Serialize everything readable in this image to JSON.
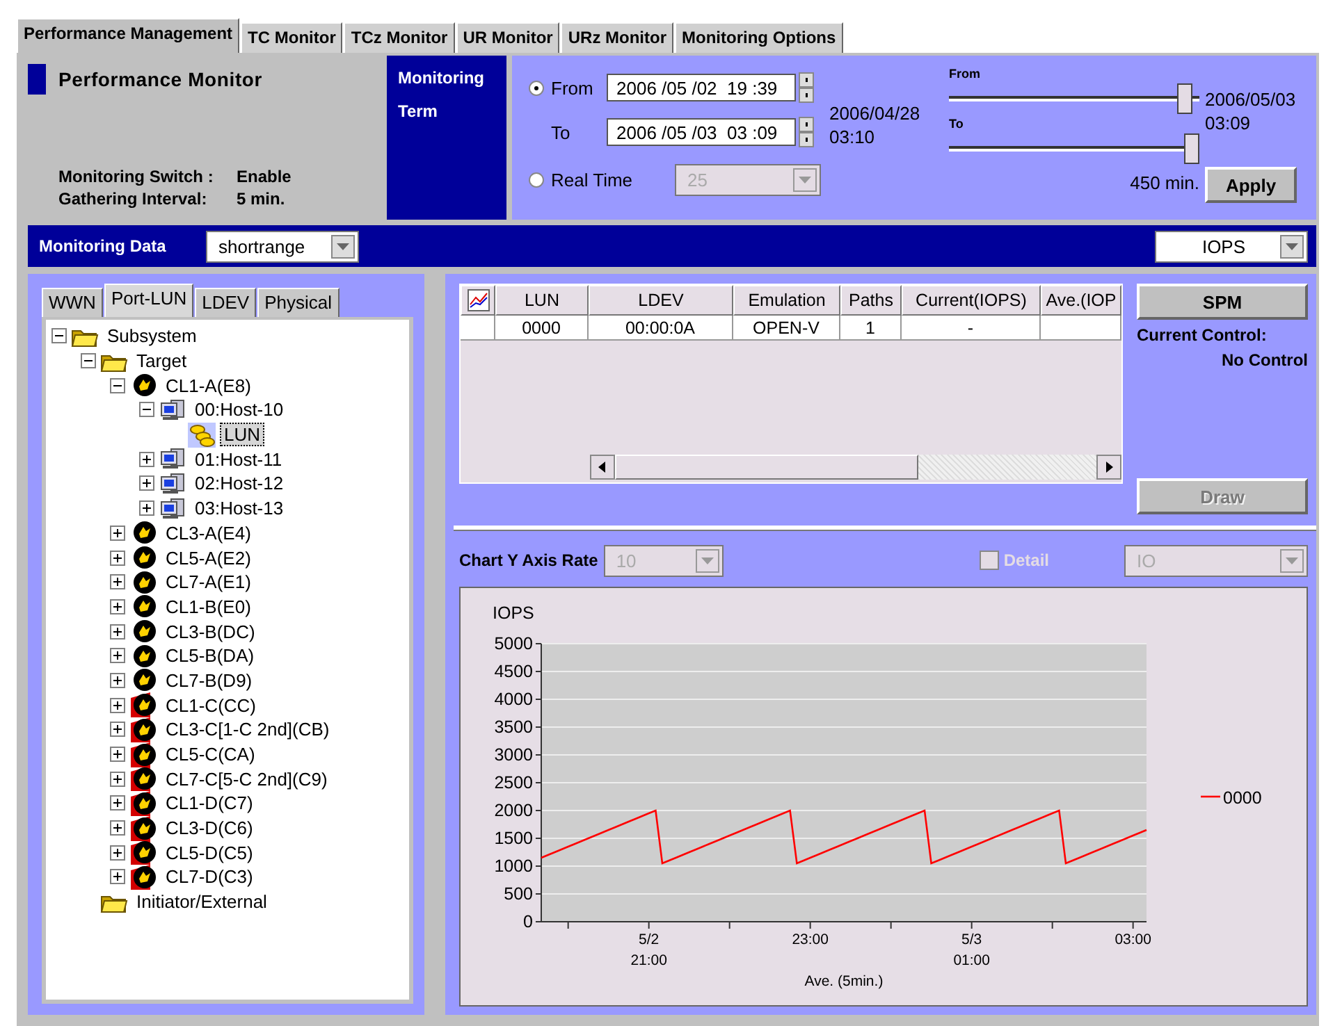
{
  "tabs": [
    {
      "label": "Performance Management",
      "selected": true
    },
    {
      "label": "TC Monitor",
      "selected": false
    },
    {
      "label": "TCz Monitor",
      "selected": false
    },
    {
      "label": "UR Monitor",
      "selected": false
    },
    {
      "label": "URz Monitor",
      "selected": false
    },
    {
      "label": "Monitoring Options",
      "selected": false
    }
  ],
  "header": {
    "title": "Performance Monitor",
    "status": [
      {
        "label": "Monitoring Switch :",
        "value": "Enable"
      },
      {
        "label": "Gathering Interval:",
        "value": "5 min."
      }
    ]
  },
  "term": {
    "title": [
      "Monitoring",
      "Term"
    ],
    "from": {
      "label": "From",
      "selected": true,
      "value": "2006 /05 /02  19 :39"
    },
    "to": {
      "label": "To",
      "value": "2006 /05 /03  03 :09"
    },
    "realtime": {
      "label": "Real Time",
      "selected": false,
      "value": "25",
      "disabled": true
    },
    "range_start": [
      "2006/04/28",
      "03:10"
    ],
    "range_end": [
      "2006/05/03",
      "03:09"
    ],
    "from_slider": {
      "label": "From",
      "level": 0.97
    },
    "to_slider": {
      "label": "To",
      "level": 1.0
    },
    "duration": "450 min.",
    "apply": "Apply"
  },
  "monitoring_data": {
    "label": "Monitoring Data",
    "value": "shortrange",
    "metric": "IOPS"
  },
  "tree_tabs": [
    {
      "label": "WWN",
      "selected": false
    },
    {
      "label": "Port-LUN",
      "selected": true
    },
    {
      "label": "LDEV",
      "selected": false
    },
    {
      "label": "Physical",
      "selected": false
    }
  ],
  "tree": [
    {
      "label": "Subsystem",
      "kind": "folder",
      "expanded": true,
      "selected": false,
      "children": [
        {
          "label": "Target",
          "kind": "folder",
          "expanded": true,
          "selected": false,
          "children": [
            {
              "label": "CL1-A(E8)",
              "kind": "port",
              "flagged": false,
              "expanded": true,
              "selected": false,
              "children": [
                {
                  "label": "00:Host-10",
                  "kind": "host",
                  "expanded": true,
                  "selected": false,
                  "children": [
                    {
                      "label": "LUN",
                      "kind": "lun",
                      "selected": true
                    }
                  ]
                },
                {
                  "label": "01:Host-11",
                  "kind": "host",
                  "expanded": false,
                  "selected": false
                },
                {
                  "label": "02:Host-12",
                  "kind": "host",
                  "expanded": false,
                  "selected": false
                },
                {
                  "label": "03:Host-13",
                  "kind": "host",
                  "expanded": false,
                  "selected": false
                }
              ]
            },
            {
              "label": "CL3-A(E4)",
              "kind": "port",
              "flagged": false,
              "expanded": false,
              "selected": false
            },
            {
              "label": "CL5-A(E2)",
              "kind": "port",
              "flagged": false,
              "expanded": false,
              "selected": false
            },
            {
              "label": "CL7-A(E1)",
              "kind": "port",
              "flagged": false,
              "expanded": false,
              "selected": false
            },
            {
              "label": "CL1-B(E0)",
              "kind": "port",
              "flagged": false,
              "expanded": false,
              "selected": false
            },
            {
              "label": "CL3-B(DC)",
              "kind": "port",
              "flagged": false,
              "expanded": false,
              "selected": false
            },
            {
              "label": "CL5-B(DA)",
              "kind": "port",
              "flagged": false,
              "expanded": false,
              "selected": false
            },
            {
              "label": "CL7-B(D9)",
              "kind": "port",
              "flagged": false,
              "expanded": false,
              "selected": false
            },
            {
              "label": "CL1-C(CC)",
              "kind": "port",
              "flagged": true,
              "expanded": false,
              "selected": false
            },
            {
              "label": "CL3-C[1-C 2nd](CB)",
              "kind": "port",
              "flagged": true,
              "expanded": false,
              "selected": false
            },
            {
              "label": "CL5-C(CA)",
              "kind": "port",
              "flagged": true,
              "expanded": false,
              "selected": false
            },
            {
              "label": "CL7-C[5-C 2nd](C9)",
              "kind": "port",
              "flagged": true,
              "expanded": false,
              "selected": false
            },
            {
              "label": "CL1-D(C7)",
              "kind": "port",
              "flagged": true,
              "expanded": false,
              "selected": false
            },
            {
              "label": "CL3-D(C6)",
              "kind": "port",
              "flagged": true,
              "expanded": false,
              "selected": false
            },
            {
              "label": "CL5-D(C5)",
              "kind": "port",
              "flagged": true,
              "expanded": false,
              "selected": false
            },
            {
              "label": "CL7-D(C3)",
              "kind": "port",
              "flagged": true,
              "expanded": false,
              "selected": false
            }
          ]
        },
        {
          "label": "Initiator/External",
          "kind": "folder",
          "selected": false
        }
      ]
    }
  ],
  "table": {
    "columns": [
      "LUN",
      "LDEV",
      "Emulation",
      "Paths",
      "Current(IOPS)",
      "Ave.(IOP"
    ],
    "rows": [
      {
        "cells": [
          "0000",
          "00:00:0A",
          "OPEN-V",
          "1",
          "-"
        ]
      }
    ]
  },
  "side": {
    "spm": "SPM",
    "control_label": "Current Control:",
    "control_value": "No Control",
    "draw": {
      "label": "Draw",
      "disabled": true
    }
  },
  "chart_controls": {
    "y_axis_rate": {
      "label": "Chart Y Axis Rate",
      "value": "10",
      "disabled": true
    },
    "detail": {
      "label": "Detail",
      "checked": false,
      "disabled": true
    },
    "io": {
      "value": "IO",
      "disabled": true
    }
  },
  "chart": {
    "chart_data": {
      "type": "line",
      "ylabel": "IOPS",
      "xlabel": "Ave. (5min.)",
      "categories": [
        null,
        null,
        null,
        null,
        null,
        null,
        null,
        null,
        null,
        null,
        null,
        null,
        null,
        null,
        null,
        null,
        "5/2 21:00",
        null,
        null,
        null,
        null,
        null,
        null,
        null,
        null,
        null,
        null,
        null,
        null,
        null,
        null,
        null,
        null,
        null,
        null,
        null,
        null,
        null,
        null,
        null,
        "23:00",
        null,
        null,
        null,
        null,
        null,
        null,
        null,
        null,
        null,
        null,
        null,
        null,
        null,
        null,
        null,
        null,
        null,
        null,
        null,
        null,
        null,
        null,
        null,
        "5/3 01:00",
        null,
        null,
        null,
        null,
        null,
        null,
        null,
        null,
        null,
        null,
        null,
        null,
        null,
        null,
        null,
        null,
        null,
        null,
        null,
        null,
        null,
        null,
        null,
        "03:00",
        null,
        null
      ],
      "series": [
        {
          "name": "0000",
          "color": "#ff0000",
          "values": [
            1150,
            1200,
            1250,
            1300,
            1350,
            1400,
            1450,
            1500,
            1550,
            1600,
            1650,
            1700,
            1750,
            1800,
            1850,
            1900,
            1950,
            2000,
            1050,
            1100,
            1150,
            1200,
            1250,
            1300,
            1350,
            1400,
            1450,
            1500,
            1550,
            1600,
            1650,
            1700,
            1750,
            1800,
            1850,
            1900,
            1950,
            2000,
            1050,
            1100,
            1150,
            1200,
            1250,
            1300,
            1350,
            1400,
            1450,
            1500,
            1550,
            1600,
            1650,
            1700,
            1750,
            1800,
            1850,
            1900,
            1950,
            2000,
            1050,
            1100,
            1150,
            1200,
            1250,
            1300,
            1350,
            1400,
            1450,
            1500,
            1550,
            1600,
            1650,
            1700,
            1750,
            1800,
            1850,
            1900,
            1950,
            2000,
            1050,
            1100,
            1150,
            1200,
            1250,
            1300,
            1350,
            1400,
            1450,
            1500,
            1550,
            1600,
            1650
          ]
        }
      ],
      "ylim": [
        0,
        5000
      ],
      "grid": true,
      "yticks": [
        0,
        500,
        1000,
        1500,
        2000,
        2500,
        3000,
        3500,
        4000,
        4500,
        5000
      ]
    }
  }
}
